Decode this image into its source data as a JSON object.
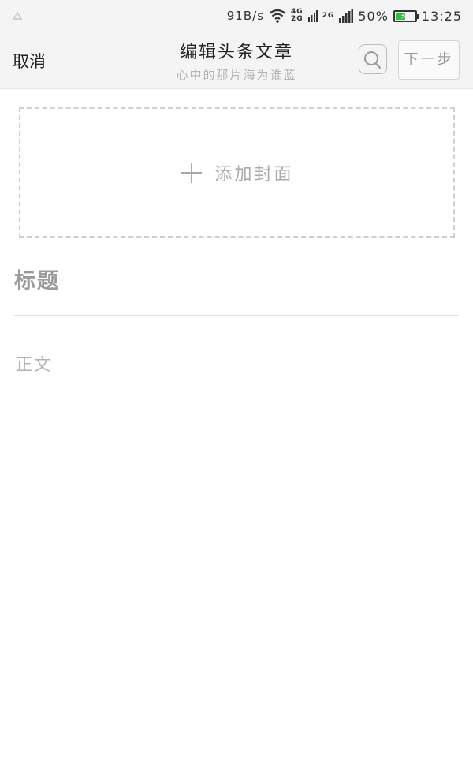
{
  "status_bar": {
    "net_speed": "91B/s",
    "net_type_top": "4G",
    "net_type_bottom": "2G",
    "net_type_2": "2G",
    "battery_percent_text": "50%",
    "battery_level": 0.5,
    "time": "13:25",
    "icons": [
      "notification-icon",
      "wifi-icon",
      "signal-icon",
      "battery-icon"
    ]
  },
  "header": {
    "cancel_label": "取消",
    "title": "编辑头条文章",
    "subtitle": "心中的那片海为谁蓝",
    "search_icon": "search-icon",
    "next_label": "下一步"
  },
  "editor": {
    "add_cover_icon": "plus-icon",
    "add_cover_label": "添加封面",
    "title_placeholder": "标题",
    "body_placeholder": "正文"
  },
  "colors": {
    "bar_background": "#f4f4f4",
    "battery_green": "#2fbf3c",
    "placeholder_gray": "#b0b0b0"
  }
}
